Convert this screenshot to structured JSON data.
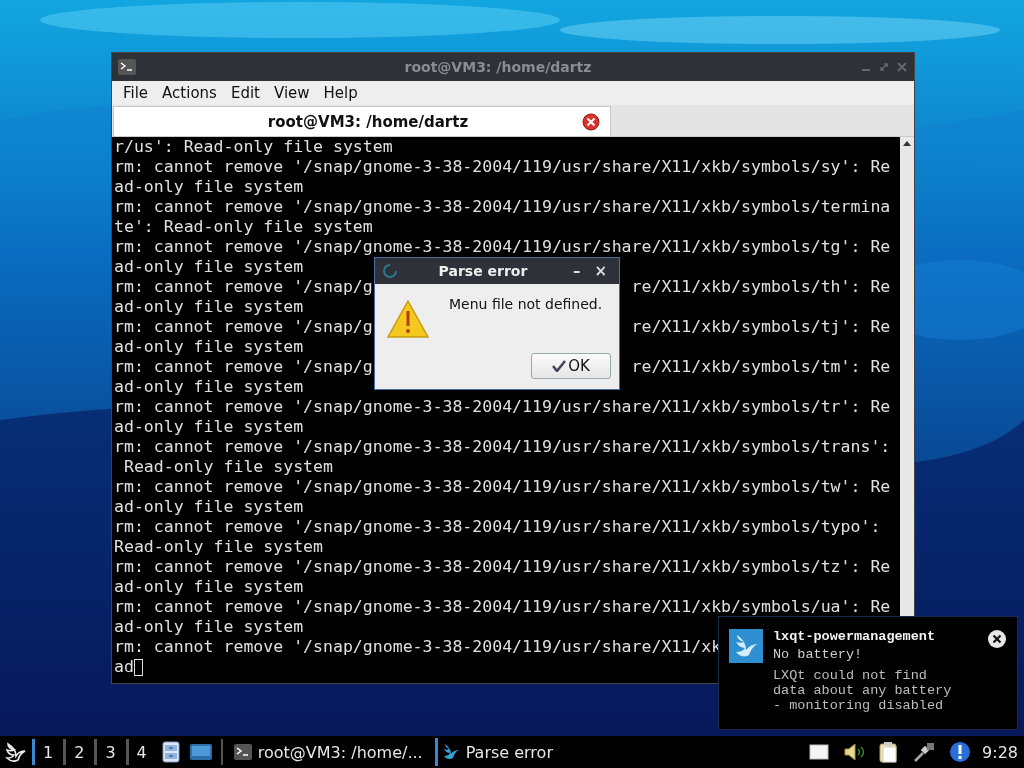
{
  "terminal_window": {
    "title": "root@VM3: /home/dartz",
    "menu": [
      "File",
      "Actions",
      "Edit",
      "View",
      "Help"
    ],
    "tabs": [
      {
        "label": "root@VM3: /home/dartz",
        "selected": true
      }
    ],
    "lines": [
      {
        "text": "r/us': Read-only file system"
      },
      {
        "text": "rm: cannot remove '/snap/gnome-3-38-2004/119/usr/share/X11/xkb/symbols/sy': Re"
      },
      {
        "text": "ad-only file system"
      },
      {
        "text": "rm: cannot remove '/snap/gnome-3-38-2004/119/usr/share/X11/xkb/symbols/termina"
      },
      {
        "text": "te': Read-only file system"
      },
      {
        "text": "rm: cannot remove '/snap/gnome-3-38-2004/119/usr/share/X11/xkb/symbols/tg': Re"
      },
      {
        "text": "ad-only file system"
      },
      {
        "left": "rm: cannot remove '/snap/g",
        "right": "re/X11/xkb/symbols/th': Re"
      },
      {
        "text": "ad-only file system"
      },
      {
        "left": "rm: cannot remove '/snap/g",
        "right": "re/X11/xkb/symbols/tj': Re"
      },
      {
        "text": "ad-only file system"
      },
      {
        "left": "rm: cannot remove '/snap/g",
        "right": "re/X11/xkb/symbols/tm': Re"
      },
      {
        "text": "ad-only file system"
      },
      {
        "text": "rm: cannot remove '/snap/gnome-3-38-2004/119/usr/share/X11/xkb/symbols/tr': Re"
      },
      {
        "text": "ad-only file system"
      },
      {
        "text": "rm: cannot remove '/snap/gnome-3-38-2004/119/usr/share/X11/xkb/symbols/trans':"
      },
      {
        "text": " Read-only file system"
      },
      {
        "text": "rm: cannot remove '/snap/gnome-3-38-2004/119/usr/share/X11/xkb/symbols/tw': Re"
      },
      {
        "text": "ad-only file system"
      },
      {
        "text": "rm: cannot remove '/snap/gnome-3-38-2004/119/usr/share/X11/xkb/symbols/typo':"
      },
      {
        "text": "Read-only file system"
      },
      {
        "text": "rm: cannot remove '/snap/gnome-3-38-2004/119/usr/share/X11/xkb/symbols/tz': Re"
      },
      {
        "text": "ad-only file system"
      },
      {
        "text": "rm: cannot remove '/snap/gnome-3-38-2004/119/usr/share/X11/xkb/symbols/ua': Re"
      },
      {
        "text": "ad-only file system"
      },
      {
        "text": "rm: cannot remove '/snap/gnome-3-38-2004/119/usr/share/X11/xk"
      },
      {
        "text": "ad",
        "cursor": true
      }
    ]
  },
  "dialog": {
    "title": "Parse error",
    "minimize": "–",
    "close": "×",
    "message": "Menu file not defined.",
    "button": "OK"
  },
  "notification": {
    "app": "lxqt-powermanagement",
    "summary": "No battery!",
    "body": "LXQt could not find\ndata about any battery\n- monitoring disabled"
  },
  "taskbar": {
    "desktops": [
      {
        "label": "1",
        "selected": true
      },
      {
        "label": "2",
        "selected": false
      },
      {
        "label": "3",
        "selected": false
      },
      {
        "label": "4",
        "selected": false
      }
    ],
    "tasks": [
      {
        "label": "root@VM3: /home/...",
        "kind": "terminal",
        "selected": false
      },
      {
        "label": "Parse error",
        "kind": "bird",
        "selected": true
      }
    ],
    "clock": "9:28"
  }
}
